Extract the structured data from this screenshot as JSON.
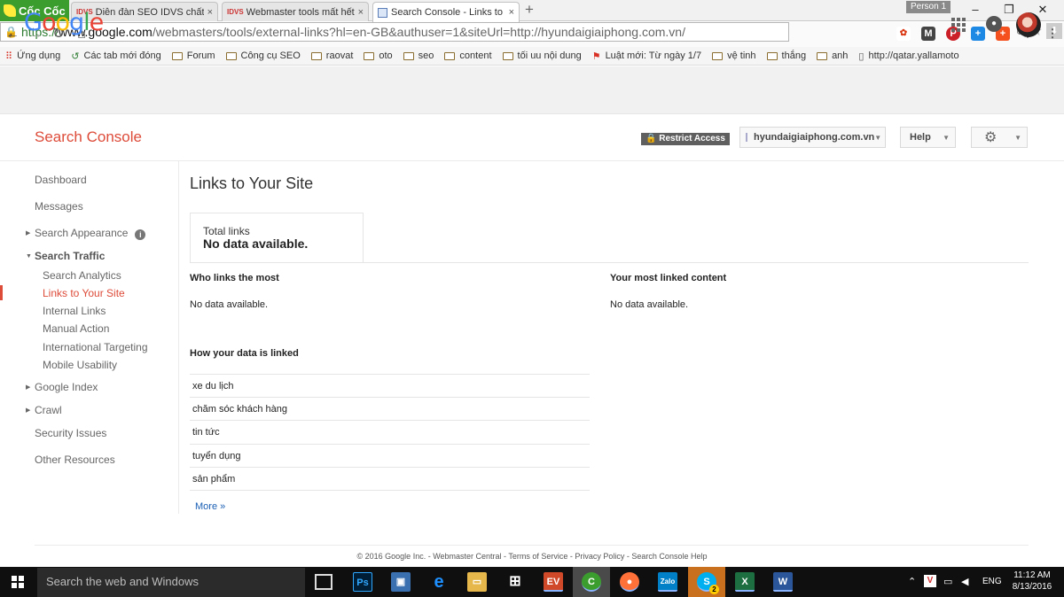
{
  "browser": {
    "brand": "Cốc Cốc",
    "tabs": [
      {
        "favicon": "IDVS",
        "title": "Diễn đàn SEO IDVS chất lư",
        "close": "×"
      },
      {
        "favicon": "IDVS",
        "title": "Webmaster tools mất hết li",
        "close": "×"
      },
      {
        "favicon": "search-console-favicon",
        "title": "Search Console - Links to Y",
        "close": "×"
      }
    ],
    "new_tab": "+",
    "person": "Person 1",
    "window": {
      "minimize": "–",
      "restore": "❐",
      "close": "✕"
    },
    "nav": {
      "back": "←",
      "forward": "→",
      "reload": "↻",
      "home": "⌂"
    },
    "address": {
      "scheme": "https://",
      "host": "www.google.com",
      "rest": "/webmasters/tools/external-links?hl=en-GB&authuser=1&siteUrl=http://hyundaigiaiphong.com.vn/"
    },
    "bookmarks": [
      {
        "icon": "apps",
        "label": "Ứng dụng"
      },
      {
        "icon": "history",
        "label": "Các tab mới đóng"
      },
      {
        "icon": "folder",
        "label": "Forum"
      },
      {
        "icon": "folder",
        "label": "Công cụ SEO"
      },
      {
        "icon": "folder",
        "label": "raovat"
      },
      {
        "icon": "folder",
        "label": "oto"
      },
      {
        "icon": "folder",
        "label": "seo"
      },
      {
        "icon": "folder",
        "label": "content"
      },
      {
        "icon": "folder",
        "label": "tối uu nội dung"
      },
      {
        "icon": "flag",
        "label": "Luật mới: Từ ngày 1/7"
      },
      {
        "icon": "folder",
        "label": "vệ tinh"
      },
      {
        "icon": "folder",
        "label": "thắng"
      },
      {
        "icon": "folder",
        "label": "anh"
      },
      {
        "icon": "page",
        "label": "http://qatar.yallamoto"
      }
    ]
  },
  "google": {
    "logo": [
      "G",
      "o",
      "o",
      "g",
      "l",
      "e"
    ],
    "logo_colors": [
      "#4285F4",
      "#EA4335",
      "#FBBC05",
      "#4285F4",
      "#34A853",
      "#EA4335"
    ]
  },
  "console": {
    "title": "Search Console",
    "restrict": "Restrict Access",
    "site": "hyundaigiaiphong.com.vn",
    "help": "Help",
    "accent": "#dd4b39"
  },
  "sidebar": {
    "dashboard": "Dashboard",
    "messages": "Messages",
    "search_appearance": "Search Appearance",
    "search_traffic": "Search Traffic",
    "search_analytics": "Search Analytics",
    "links_to_site": "Links to Your Site",
    "internal_links": "Internal Links",
    "manual_action": "Manual Action",
    "international_targeting": "International Targeting",
    "mobile_usability": "Mobile Usability",
    "google_index": "Google Index",
    "crawl": "Crawl",
    "security_issues": "Security Issues",
    "other_resources": "Other Resources"
  },
  "main": {
    "title": "Links to Your Site",
    "total_label": "Total links",
    "total_value": "No data available.",
    "who_links_title": "Who links the most",
    "who_links_value": "No data available.",
    "linked_content_title": "Your most linked content",
    "linked_content_value": "No data available.",
    "how_linked_title": "How your data is linked",
    "anchors": [
      "xe du lịch",
      "chăm sóc khách hàng",
      "tin tức",
      "tuyển dụng",
      "sản phẩm"
    ],
    "more": "More »"
  },
  "footer": "© 2016 Google Inc. - Webmaster Central - Terms of Service - Privacy Policy - Search Console Help",
  "taskbar": {
    "search_placeholder": "Search the web and Windows",
    "lang": "ENG",
    "time": "11:12 AM",
    "date": "8/13/2016",
    "skype_badge": "2"
  }
}
